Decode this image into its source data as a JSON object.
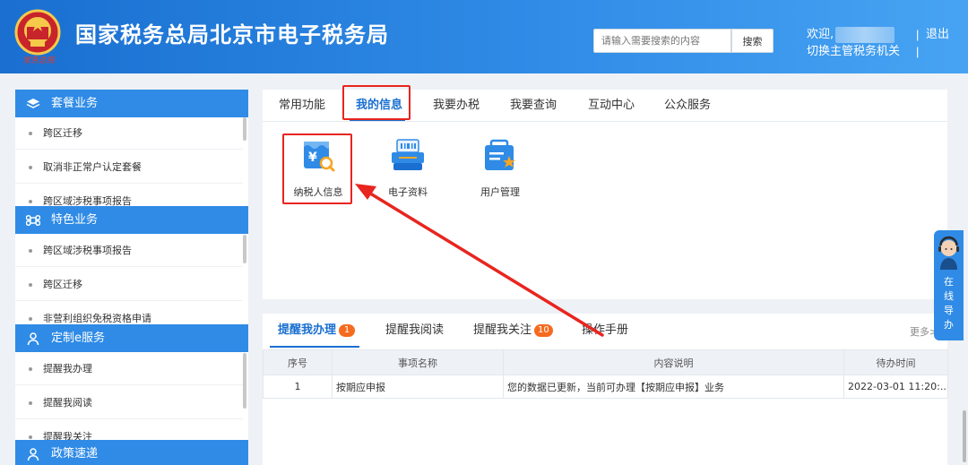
{
  "header": {
    "title": "国家税务总局北京市电子税务局",
    "emblem_subtext": "常务总局",
    "search_placeholder": "请输入需要搜索的内容",
    "search_button": "搜索",
    "welcome": "欢迎,",
    "switch_authority": "切换主管税务机关",
    "sep": "|",
    "logout": "退出"
  },
  "sidebar": {
    "sections": [
      {
        "title": "套餐业务",
        "icon": "layers-icon",
        "items": [
          "跨区迁移",
          "取消非正常户认定套餐",
          "跨区域涉税事项报告"
        ]
      },
      {
        "title": "特色业务",
        "icon": "command-icon",
        "items": [
          "跨区域涉税事项报告",
          "跨区迁移",
          "非营利组织免税资格申请"
        ]
      },
      {
        "title": "定制e服务",
        "icon": "user-icon",
        "items": [
          "提醒我办理",
          "提醒我阅读",
          "提醒我关注"
        ]
      },
      {
        "title": "政策速递",
        "icon": "user-icon",
        "items": []
      }
    ]
  },
  "main_tabs": [
    "常用功能",
    "我的信息",
    "我要办税",
    "我要查询",
    "互动中心",
    "公众服务"
  ],
  "apps": [
    {
      "label": "纳税人信息",
      "icon": "taxpayer-info-icon"
    },
    {
      "label": "电子资料",
      "icon": "electronic-docs-icon"
    },
    {
      "label": "用户管理",
      "icon": "user-management-icon"
    }
  ],
  "reminder_tabs": [
    {
      "label": "提醒我办理",
      "badge": "1"
    },
    {
      "label": "提醒我阅读",
      "badge": ""
    },
    {
      "label": "提醒我关注",
      "badge": "10"
    },
    {
      "label": "操作手册",
      "badge": ""
    }
  ],
  "more": "更多>",
  "table": {
    "headers": [
      "序号",
      "事项名称",
      "内容说明",
      "待办时间"
    ],
    "rows": [
      [
        "1",
        "按期应申报",
        "您的数据已更新，当前可办理【按期应申报】业务",
        "2022-03-01 11:20:..."
      ]
    ]
  },
  "float_guide": {
    "text": "在\n线\n导\n办"
  },
  "colors": {
    "primary": "#1a6fd0",
    "header_blue": "#2f8be6",
    "annotation_red": "#e8251f",
    "badge_orange": "#f56b1f"
  }
}
